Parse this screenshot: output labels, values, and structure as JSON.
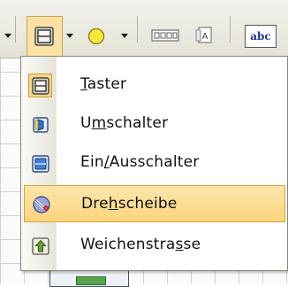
{
  "toolbar": {
    "buttons": [
      {
        "name": "button-shape-dropdown",
        "icon": "rectangle-button-icon"
      },
      {
        "name": "circle-shape-dropdown",
        "icon": "yellow-circle-icon"
      },
      {
        "name": "segment-display-button",
        "icon": "segment-display-icon"
      },
      {
        "name": "letter-box-button",
        "icon": "letter-box-icon"
      },
      {
        "name": "text-label-button",
        "icon": "text-label-icon",
        "label": "abc"
      }
    ]
  },
  "menu": {
    "items": [
      {
        "label_pre": "",
        "label_underline": "T",
        "label_post": "aster",
        "icon": "push-button-icon",
        "state": "checked"
      },
      {
        "label_pre": "U",
        "label_underline": "m",
        "label_post": "schalter",
        "icon": "changeover-switch-icon",
        "state": "normal"
      },
      {
        "label_pre": "Ein",
        "label_underline": "/",
        "label_post": "Ausschalter",
        "icon": "on-off-switch-icon",
        "state": "normal"
      },
      {
        "label_pre": "Dre",
        "label_underline": "h",
        "label_post": "scheibe",
        "icon": "turntable-icon",
        "state": "hovered"
      },
      {
        "label_pre": "Weichenstra",
        "label_underline": "s",
        "label_post": "se",
        "icon": "route-up-arrow-icon",
        "state": "normal"
      }
    ]
  },
  "colors": {
    "highlight": "#fbd47c",
    "highlight_border": "#d6a43d",
    "menu_border": "#8a877a",
    "toolbar_bg": "#e4e2d6"
  }
}
